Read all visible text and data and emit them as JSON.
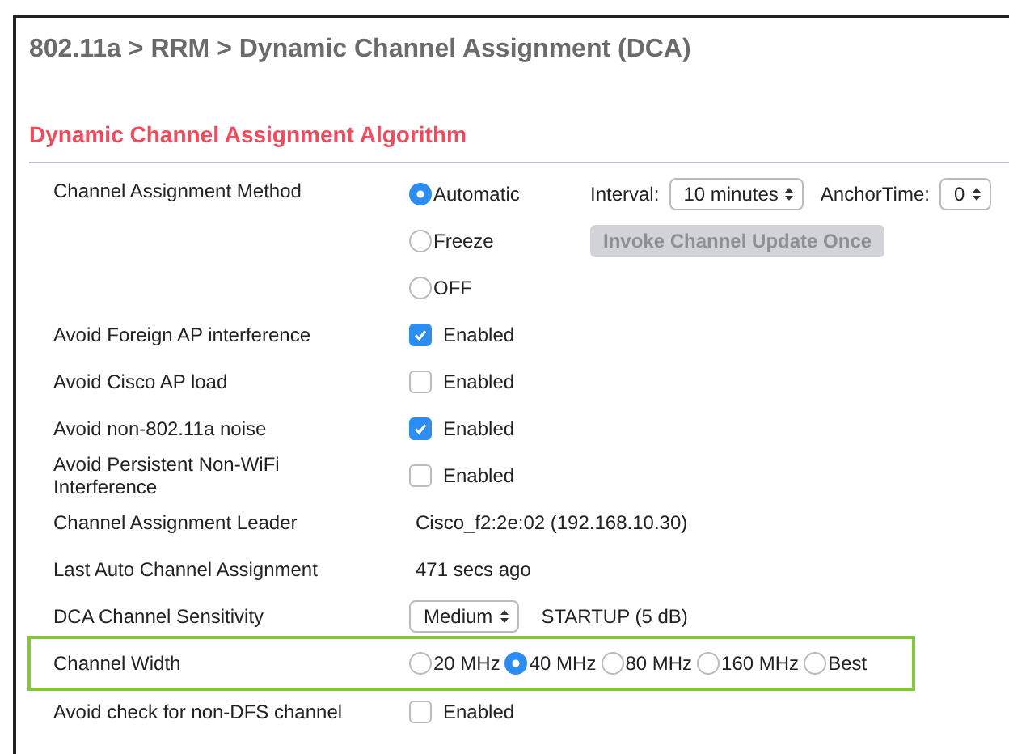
{
  "breadcrumb": "802.11a > RRM > Dynamic Channel Assignment (DCA)",
  "section_title": "Dynamic Channel Assignment Algorithm",
  "rows": [
    {
      "kind": "method",
      "label": "Channel Assignment Method",
      "options": [
        {
          "label": "Automatic",
          "selected": true
        },
        {
          "label": "Freeze",
          "selected": false
        },
        {
          "label": "OFF",
          "selected": false
        }
      ],
      "interval": {
        "label": "Interval:",
        "value": "10 minutes"
      },
      "anchor": {
        "label": "AnchorTime:",
        "value": "0"
      },
      "action": {
        "label": "Invoke Channel Update Once",
        "disabled": true
      }
    },
    {
      "kind": "checkbox",
      "label": "Avoid Foreign AP interference",
      "checked": true,
      "text": "Enabled"
    },
    {
      "kind": "checkbox",
      "label": "Avoid Cisco AP load",
      "checked": false,
      "text": "Enabled"
    },
    {
      "kind": "checkbox",
      "label": "Avoid non-802.11a noise",
      "checked": true,
      "text": "Enabled"
    },
    {
      "kind": "checkbox",
      "label": "Avoid Persistent Non-WiFi Interference",
      "checked": false,
      "text": "Enabled"
    },
    {
      "kind": "text",
      "label": "Channel Assignment Leader",
      "value": "Cisco_f2:2e:02 (192.168.10.30)"
    },
    {
      "kind": "text",
      "label": "Last Auto Channel Assignment",
      "value": "471 secs ago"
    },
    {
      "kind": "select",
      "label": "DCA Channel Sensitivity",
      "value": "Medium",
      "note": "STARTUP (5 dB)"
    },
    {
      "kind": "radio",
      "label": "Channel Width",
      "highlighted": true,
      "options": [
        {
          "label": "20 MHz",
          "selected": false
        },
        {
          "label": "40 MHz",
          "selected": true
        },
        {
          "label": "80 MHz",
          "selected": false
        },
        {
          "label": "160 MHz",
          "selected": false
        },
        {
          "label": "Best",
          "selected": false
        }
      ]
    },
    {
      "kind": "checkbox",
      "label": "Avoid check for non-DFS channel",
      "checked": false,
      "text": "Enabled"
    }
  ]
}
